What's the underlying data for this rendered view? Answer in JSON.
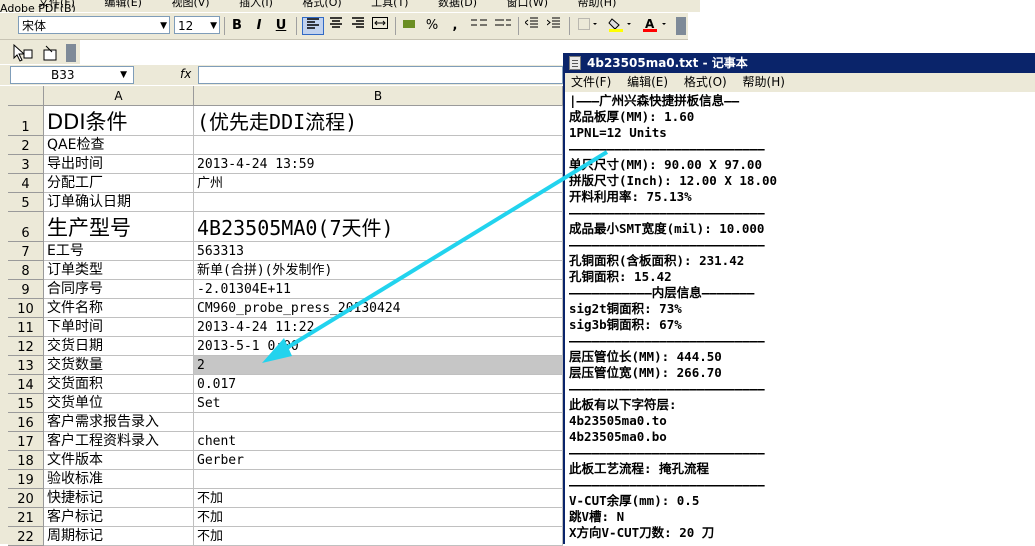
{
  "excel": {
    "menu": [
      "文件(F)",
      "编辑(E)",
      "视图(V)",
      "插入(I)",
      "格式(O)",
      "工具(T)",
      "数据(D)",
      "窗口(W)",
      "帮助(H)",
      "Adobe PDF(B)"
    ],
    "toolbar": {
      "font_name": "宋体",
      "font_size": "12",
      "bold": "B",
      "italic": "I",
      "underline": "U",
      "percent": "%",
      "comma": ","
    },
    "name_box": "B33",
    "fx": "fx",
    "columns": [
      "A",
      "B"
    ],
    "rows": [
      {
        "n": "1",
        "a": "DDI条件",
        "b": "(优先走DDI流程)"
      },
      {
        "n": "2",
        "a": "QAE检查",
        "b": ""
      },
      {
        "n": "3",
        "a": "导出时间",
        "b": "2013-4-24 13:59"
      },
      {
        "n": "4",
        "a": "分配工厂",
        "b": "广州"
      },
      {
        "n": "5",
        "a": "订单确认日期",
        "b": ""
      },
      {
        "n": "6",
        "a": "生产型号",
        "b": "4B23505MA0(7天件)"
      },
      {
        "n": "7",
        "a": "E工号",
        "b": "563313"
      },
      {
        "n": "8",
        "a": "订单类型",
        "b": "新单(合拼)(外发制作)"
      },
      {
        "n": "9",
        "a": "合同序号",
        "b": "-2.01304E+11"
      },
      {
        "n": "10",
        "a": "文件名称",
        "b": "CM960_probe_press_20130424"
      },
      {
        "n": "11",
        "a": "下单时间",
        "b": "2013-4-24 11:22"
      },
      {
        "n": "12",
        "a": "交货日期",
        "b": "2013-5-1 0:00"
      },
      {
        "n": "13",
        "a": "交货数量",
        "b": "2"
      },
      {
        "n": "14",
        "a": "交货面积",
        "b": "0.017"
      },
      {
        "n": "15",
        "a": "交货单位",
        "b": "Set"
      },
      {
        "n": "16",
        "a": "客户需求报告录入",
        "b": ""
      },
      {
        "n": "17",
        "a": "客户工程资料录入",
        "b": "chent"
      },
      {
        "n": "18",
        "a": "文件版本",
        "b": "Gerber"
      },
      {
        "n": "19",
        "a": "验收标准",
        "b": ""
      },
      {
        "n": "20",
        "a": "快捷标记",
        "b": "不加"
      },
      {
        "n": "21",
        "a": "客户标记",
        "b": "不加"
      },
      {
        "n": "22",
        "a": "周期标记",
        "b": "不加"
      }
    ]
  },
  "notepad": {
    "title": "4b23505ma0.txt - 记事本",
    "menu": [
      "文件(F)",
      "编辑(E)",
      "格式(O)",
      "帮助(H)"
    ],
    "lines": [
      "|———广州兴森快捷拼板信息——",
      "成品板厚(MM): 1.60",
      "1PNL=12 Units",
      "——————————————————————————",
      "单只尺寸(MM): 90.00 X 97.00",
      "拼版尺寸(Inch): 12.00 X 18.00",
      "开料利用率: 75.13%",
      "——————————————————————————",
      "成品最小SMT宽度(mil): 10.000",
      "——————————————————————————",
      "孔铜面积(含板面积): 231.42",
      "孔铜面积: 15.42",
      "———————————内层信息———————",
      "sig2t铜面积: 73%",
      "sig3b铜面积: 67%",
      "——————————————————————————",
      "层压管位长(MM): 444.50",
      "层压管位宽(MM): 266.70",
      "——————————————————————————",
      "此板有以下字符层:",
      "4b23505ma0.to",
      "4b23505ma0.bo",
      "——————————————————————————",
      "此板工艺流程: 掩孔流程",
      "——————————————————————————",
      "V-CUT余厚(mm): 0.5",
      "跳V槽: N",
      "X方向V-CUT刀数: 20 刀"
    ]
  },
  "colors": {
    "arrow": "#22d3ee",
    "selection": "#c6c6c6",
    "titlebar": "#0a246a"
  }
}
